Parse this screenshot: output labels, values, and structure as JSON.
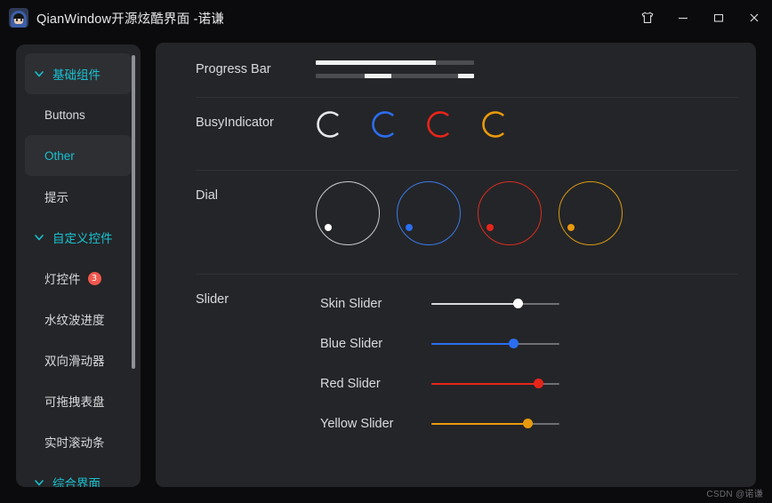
{
  "window": {
    "title": "QianWindow开源炫酷界面  -诺谦",
    "app_icon": "avatar-icon",
    "controls": [
      {
        "name": "skin",
        "icon": "tshirt-icon",
        "label": ""
      },
      {
        "name": "minimize",
        "icon": "minimize-icon",
        "label": ""
      },
      {
        "name": "maximize",
        "icon": "maximize-icon",
        "label": ""
      },
      {
        "name": "close",
        "icon": "close-icon",
        "label": ""
      }
    ]
  },
  "sidebar": {
    "scrollbar": {
      "visible": true
    },
    "items": [
      {
        "key": "basic-components",
        "label": "基础组件",
        "type": "group",
        "expanded": true,
        "active": true
      },
      {
        "key": "buttons",
        "label": "Buttons",
        "type": "leaf",
        "active": false
      },
      {
        "key": "other",
        "label": "Other",
        "type": "leaf",
        "active": true
      },
      {
        "key": "tips",
        "label": "提示",
        "type": "leaf",
        "active": false
      },
      {
        "key": "custom-controls",
        "label": "自定义控件",
        "type": "group",
        "expanded": true,
        "active": false
      },
      {
        "key": "light-control",
        "label": "灯控件",
        "type": "leaf",
        "active": false,
        "badge": "3"
      },
      {
        "key": "water-ripple-progress",
        "label": "水纹波进度",
        "type": "leaf",
        "active": false
      },
      {
        "key": "bidirectional-slider",
        "label": "双向滑动器",
        "type": "leaf",
        "active": false
      },
      {
        "key": "draggable-dial",
        "label": "可拖拽表盘",
        "type": "leaf",
        "active": false
      },
      {
        "key": "realtime-scrollbar",
        "label": "实时滚动条",
        "type": "leaf",
        "active": false
      },
      {
        "key": "partial-bottom",
        "label": "综合界面",
        "type": "group",
        "expanded": true,
        "active": false
      }
    ]
  },
  "panel": {
    "rows": [
      {
        "key": "progress-bar",
        "label": "Progress Bar",
        "bars": [
          {
            "name": "determinate",
            "value": 76,
            "segments": [
              {
                "start": 0,
                "width": 76
              }
            ]
          },
          {
            "name": "indeterminate",
            "value": 0,
            "segments": [
              {
                "start": 31,
                "width": 17
              },
              {
                "start": 90,
                "width": 10
              }
            ]
          }
        ]
      },
      {
        "key": "busy-indicator",
        "label": "BusyIndicator",
        "indicators": [
          {
            "name": "skin",
            "color": "#e6e7ea"
          },
          {
            "name": "blue",
            "color": "#2b6ef0"
          },
          {
            "name": "red",
            "color": "#e8241a"
          },
          {
            "name": "yellow",
            "color": "#e99a0c"
          }
        ]
      },
      {
        "key": "dial",
        "label": "Dial",
        "dials": [
          {
            "name": "skin",
            "color": "#c9cbcf",
            "handle_color": "#ffffff",
            "value": 12
          },
          {
            "name": "blue",
            "color": "#3a7ae8",
            "handle_color": "#2b6ef0",
            "value": 12
          },
          {
            "name": "red",
            "color": "#d82d20",
            "handle_color": "#e8241a",
            "value": 12
          },
          {
            "name": "yellow",
            "color": "#d99a14",
            "handle_color": "#e99a0c",
            "value": 12
          }
        ]
      },
      {
        "key": "slider",
        "label": "Slider",
        "sliders": [
          {
            "name": "skin-slider",
            "label": "Skin Slider",
            "value": 68,
            "color": "#d7d9dc",
            "knob_color": "#ffffff"
          },
          {
            "name": "blue-slider",
            "label": "Blue Slider",
            "value": 64,
            "color": "#2b6ef0",
            "knob_color": "#2b6ef0"
          },
          {
            "name": "red-slider",
            "label": "Red Slider",
            "value": 84,
            "color": "#e8241a",
            "knob_color": "#e8241a"
          },
          {
            "name": "yellow-slider",
            "label": "Yellow Slider",
            "value": 75,
            "color": "#e99a0c",
            "knob_color": "#e99a0c"
          }
        ]
      }
    ]
  },
  "watermark": "CSDN @诺谦",
  "colors": {
    "accent": "#18c0cf",
    "badge": "#f0584e",
    "panel_bg": "#242528",
    "window_bg": "#0b0b0d",
    "active_item_bg": "#2d2f33"
  }
}
